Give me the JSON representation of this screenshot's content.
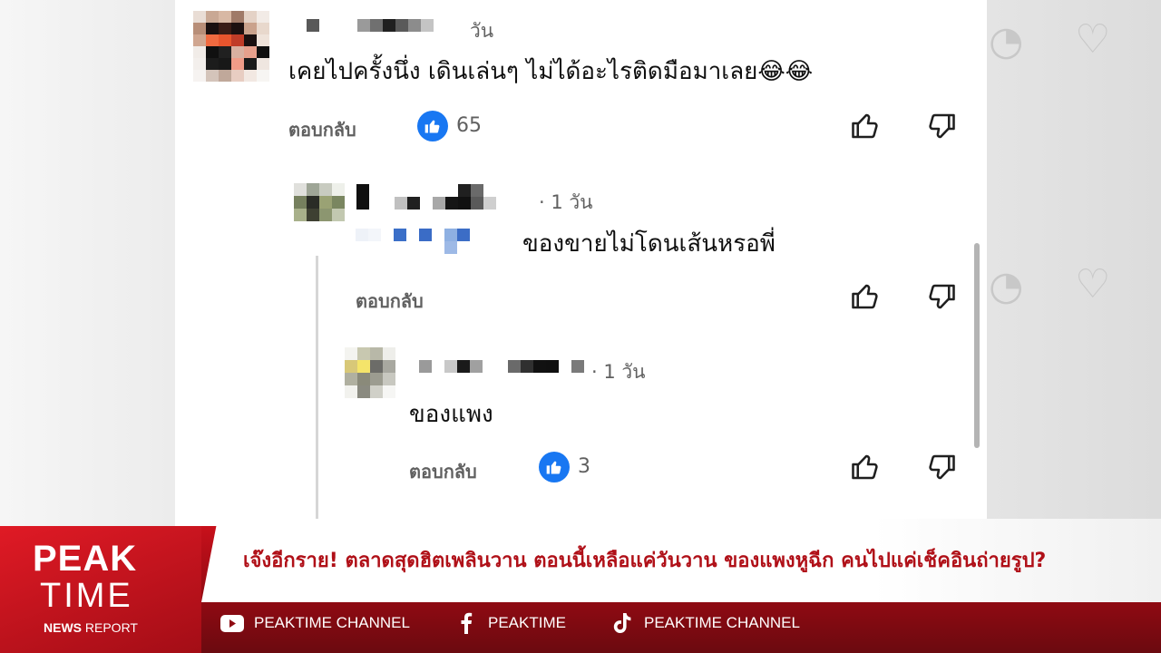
{
  "comments": [
    {
      "time": "วัน",
      "text": "เคยไปครั้งนึ่ง เดินเล่นๆ ไม่ได้อะไรติดมือมาเลย",
      "emoji": "😂😂",
      "reply_label": "ตอบกลับ",
      "likes": "65"
    },
    {
      "time": "· 1 วัน",
      "text": "ของขายไม่โดนเส้นหรอพี่",
      "reply_label": "ตอบกลับ"
    },
    {
      "time": "· 1 วัน",
      "text": "ของแพง",
      "reply_label": "ตอบกลับ",
      "likes": "3"
    }
  ],
  "icons": {
    "like_badge": "thumbs-up-icon",
    "like_button": "thumbs-up-outline-icon",
    "dislike_button": "thumbs-down-outline-icon"
  },
  "colors": {
    "like_badge": "#1877f2",
    "banner_red": "#c8101b",
    "headline_text": "#b01018"
  },
  "banner": {
    "logo_peak": "PEAK",
    "logo_time": "TIME",
    "logo_news": "NEWS",
    "logo_report": "REPORT",
    "headline": "เจ๊งอีกราย! ตลาดสุดฮิตเพลินวาน ตอนนี้เหลือแค่วันวาน ของแพงหูฉีก คนไปแค่เช็คอินถ่ายรูป?",
    "social": [
      {
        "icon": "youtube-icon",
        "label": "PEAKTIME CHANNEL"
      },
      {
        "icon": "facebook-icon",
        "label": "PEAKTIME"
      },
      {
        "icon": "tiktok-icon",
        "label": "PEAKTIME CHANNEL"
      }
    ]
  }
}
